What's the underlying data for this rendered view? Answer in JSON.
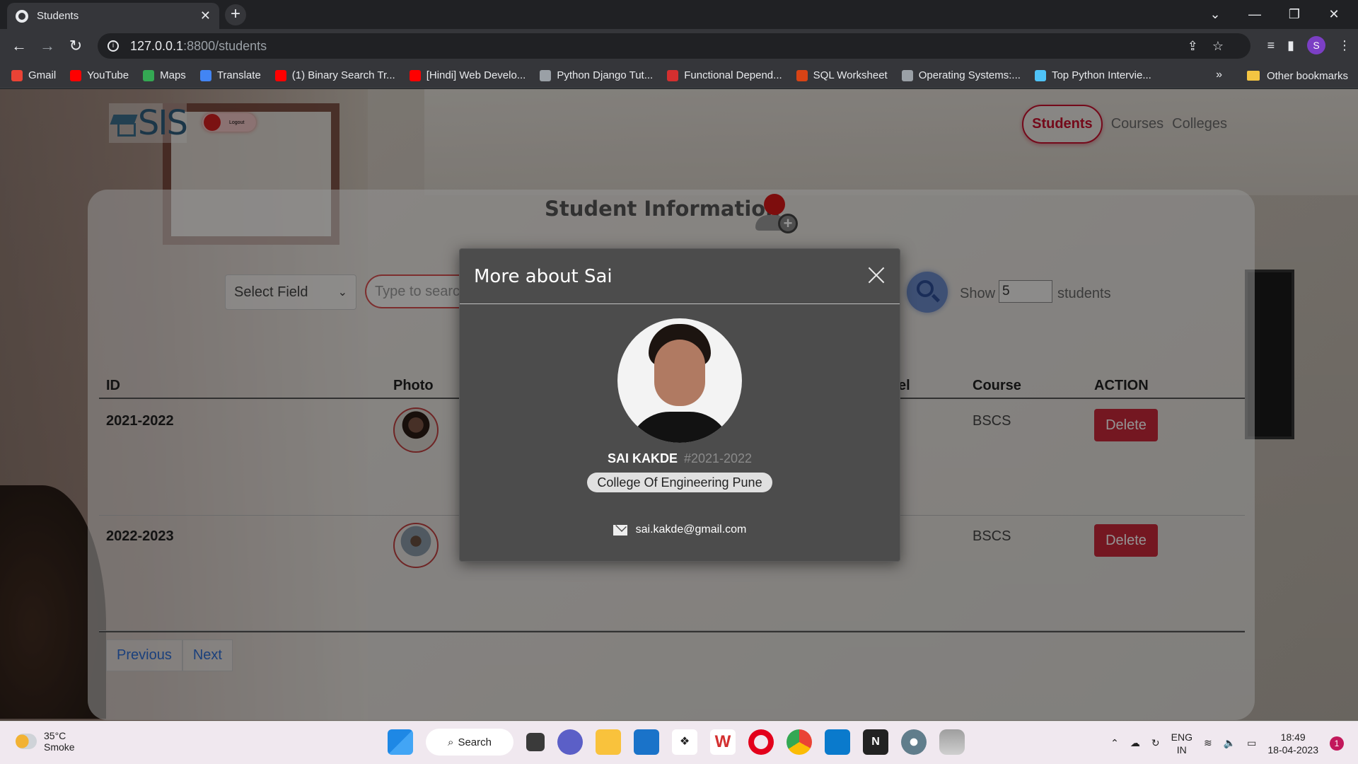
{
  "browser": {
    "tab_title": "Students",
    "url_host": "127.0.0.1",
    "url_path": ":8800/students",
    "bookmarks": [
      {
        "label": "Gmail",
        "color": "#ea4335"
      },
      {
        "label": "YouTube",
        "color": "#ff0000"
      },
      {
        "label": "Maps",
        "color": "#34a853"
      },
      {
        "label": "Translate",
        "color": "#4285f4"
      },
      {
        "label": "(1) Binary Search Tr...",
        "color": "#ff0000"
      },
      {
        "label": "[Hindi] Web Develo...",
        "color": "#ff0000"
      },
      {
        "label": "Python Django Tut...",
        "color": "#9aa0a6"
      },
      {
        "label": "Functional Depend...",
        "color": "#d32f2f"
      },
      {
        "label": "SQL Worksheet",
        "color": "#d84315"
      },
      {
        "label": "Operating Systems:...",
        "color": "#9aa0a6"
      },
      {
        "label": "Top Python Intervie...",
        "color": "#4fc3f7"
      }
    ],
    "more_bookmarks": "»",
    "other_bookmarks": "Other bookmarks",
    "profile_initial": "S"
  },
  "app": {
    "logo": "SIS",
    "logout": "Logout",
    "nav": {
      "students": "Students",
      "courses": "Courses",
      "colleges": "Colleges"
    },
    "title": "Student Information",
    "select_field": "Select Field",
    "search_placeholder": "Type to search",
    "show_label": "Show",
    "show_value": "5",
    "students_label": "students",
    "columns": {
      "id": "ID",
      "photo": "Photo",
      "level_partial": "el",
      "course": "Course",
      "action": "ACTION"
    },
    "rows": [
      {
        "id": "2021-2022",
        "course": "BSCS",
        "action": "Delete"
      },
      {
        "id": "2022-2023",
        "course": "BSCS",
        "action": "Delete"
      }
    ],
    "pager": {
      "previous": "Previous",
      "next": "Next"
    }
  },
  "modal": {
    "title": "More about Sai",
    "name": "SAI KAKDE",
    "id_tag": "#2021-2022",
    "college": "College Of Engineering Pune",
    "email": "sai.kakde@gmail.com"
  },
  "taskbar": {
    "temperature": "35°C",
    "weather": "Smoke",
    "search": "Search",
    "lang_top": "ENG",
    "lang_bottom": "IN",
    "time": "18:49",
    "date": "18-04-2023",
    "notifications": "1"
  }
}
